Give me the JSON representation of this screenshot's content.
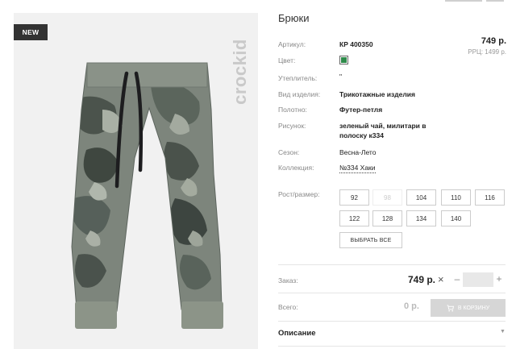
{
  "product": {
    "title": "Брюки",
    "badge": "NEW",
    "brand": "crockid",
    "price": "749 р.",
    "rrp": "РРЦ: 1499 р."
  },
  "specs": {
    "article_label": "Артикул:",
    "article_value": "КР 400350",
    "color_label": "Цвет:",
    "color_hex": "#2e8b4a",
    "insulation_label": "Утеплитель:",
    "insulation_value": "\"",
    "type_label": "Вид изделия:",
    "type_value": "Трикотажные изделия",
    "fabric_label": "Полотно:",
    "fabric_value": "Футер-петля",
    "pattern_label": "Рисунок:",
    "pattern_line1": "зеленый чай, милитари в",
    "pattern_line2": "полоску к334",
    "season_label": "Сезон:",
    "season_value": "Весна-Лето",
    "collection_label": "Коллекция:",
    "collection_value": "№334 Хаки"
  },
  "sizes": {
    "label": "Рост/размер:",
    "options": [
      "92",
      "98",
      "104",
      "110",
      "116",
      "122",
      "128",
      "134",
      "140"
    ],
    "unavailable": [
      "98"
    ],
    "select_all": "ВЫБРАТЬ ВСЕ"
  },
  "order": {
    "label": "Заказ:",
    "price": "749 р.",
    "times": "×",
    "minus": "–",
    "plus": "+",
    "quantity": ""
  },
  "total": {
    "label": "Всего:",
    "value": "0 р.",
    "cart_label": "В КОРЗИНУ"
  },
  "description": {
    "title": "Описание",
    "chevron": "▼"
  }
}
